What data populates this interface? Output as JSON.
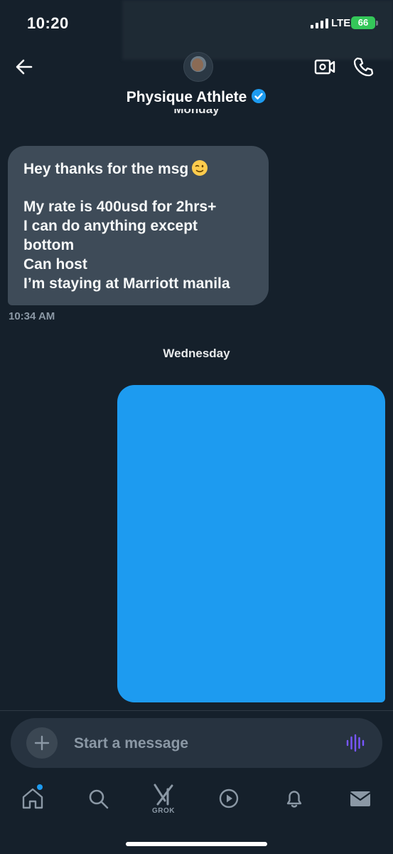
{
  "status_bar": {
    "time": "10:20",
    "network": "LTE",
    "battery": "66"
  },
  "header": {
    "contact_name": "Physique Athlete",
    "verified_badge_color": "#1d9bf0"
  },
  "conversation": {
    "day_label_1": "Monday",
    "incoming_message": {
      "lines": [
        "Hey thanks for the msg",
        "",
        "My rate is 400usd for 2hrs+",
        "I can do anything except",
        "bottom",
        "Can host",
        "I’m staying at Marriott manila"
      ],
      "emoji": "wink-emoji",
      "time": "10:34 AM"
    },
    "day_label_2": "Wednesday",
    "outgoing_message": {
      "content": "",
      "redacted": true,
      "bubble_color": "#1d9bf0"
    }
  },
  "composer": {
    "placeholder": "Start a message",
    "value": ""
  },
  "tab_bar": {
    "grok_label": "GROK",
    "items": [
      "home-icon",
      "search-icon",
      "grok-icon",
      "video-play-icon",
      "bell-icon",
      "mail-icon"
    ],
    "home_has_notification": true
  },
  "colors": {
    "background": "#15202b",
    "incoming_bubble": "#3e4b58",
    "outgoing_bubble": "#1d9bf0",
    "accent": "#1d9bf0",
    "muted_text": "#8b98a5",
    "voice_icon": "#7856ff"
  }
}
